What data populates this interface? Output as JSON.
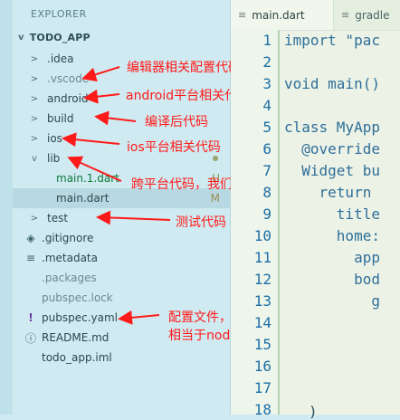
{
  "explorer": {
    "title": "EXPLORER",
    "section": "TODO_APP",
    "items": [
      {
        "label": ".idea",
        "chev": ">",
        "icon": "",
        "muted": false
      },
      {
        "label": ".vscode",
        "chev": ">",
        "icon": "",
        "muted": true
      },
      {
        "label": "android",
        "chev": ">",
        "icon": "",
        "muted": false
      },
      {
        "label": "build",
        "chev": ">",
        "icon": "",
        "muted": false
      },
      {
        "label": "ios",
        "chev": ">",
        "icon": "",
        "muted": false
      },
      {
        "label": "lib",
        "chev": "v",
        "icon": "",
        "muted": false
      },
      {
        "label": "main.1.dart",
        "chev": "",
        "icon": "",
        "muted": false,
        "status": "U"
      },
      {
        "label": "main.dart",
        "chev": "",
        "icon": "",
        "muted": false,
        "status": "M"
      },
      {
        "label": "test",
        "chev": ">",
        "icon": "",
        "muted": false
      },
      {
        "label": ".gitignore",
        "chev": "",
        "icon": "◈",
        "muted": false
      },
      {
        "label": ".metadata",
        "chev": "",
        "icon": "≡",
        "muted": false
      },
      {
        "label": ".packages",
        "chev": "",
        "icon": "",
        "muted": true
      },
      {
        "label": "pubspec.lock",
        "chev": "",
        "icon": "",
        "muted": true
      },
      {
        "label": "pubspec.yaml",
        "chev": "",
        "icon": "!",
        "muted": false
      },
      {
        "label": "README.md",
        "chev": "",
        "icon": "ⓘ",
        "muted": false
      },
      {
        "label": "todo_app.iml",
        "chev": "",
        "icon": "",
        "muted": false
      }
    ]
  },
  "annotations": {
    "vscode": "编辑器相关配置代码",
    "android": "android平台相关代码",
    "build": "编译后代码",
    "ios": "ios平台相关代码",
    "lib": "跨平台代码，我们写的代码主要在这里",
    "test": "测试代码",
    "pubspec_line1": "配置文件，一般存放第三方依赖；",
    "pubspec_line2": "相当于nodejs的package.json"
  },
  "editor": {
    "tabs": [
      {
        "label": "main.dart",
        "icon": "≡"
      },
      {
        "label": "gradle",
        "icon": "≡"
      }
    ],
    "line_numbers": [
      "1",
      "2",
      "3",
      "4",
      "5",
      "6",
      "7",
      "8",
      "9",
      "10",
      "11",
      "12",
      "13",
      "14",
      "15",
      "16",
      "17",
      "18"
    ],
    "code": {
      "l1": "import \"pac",
      "l3": "void main()",
      "l5": "class MyApp",
      "l6": "  @override",
      "l7": "  Widget bu",
      "l8": "    return ",
      "l9": "      title",
      "l10": "      home:",
      "l11": "        app",
      "l12": "        bod",
      "l13": "          g",
      "l18": ")"
    }
  },
  "colors": {
    "annotation": "#ff1a1a",
    "sidebar_bg": "#cfeaf0",
    "editor_bg": "#ecf3e6"
  }
}
